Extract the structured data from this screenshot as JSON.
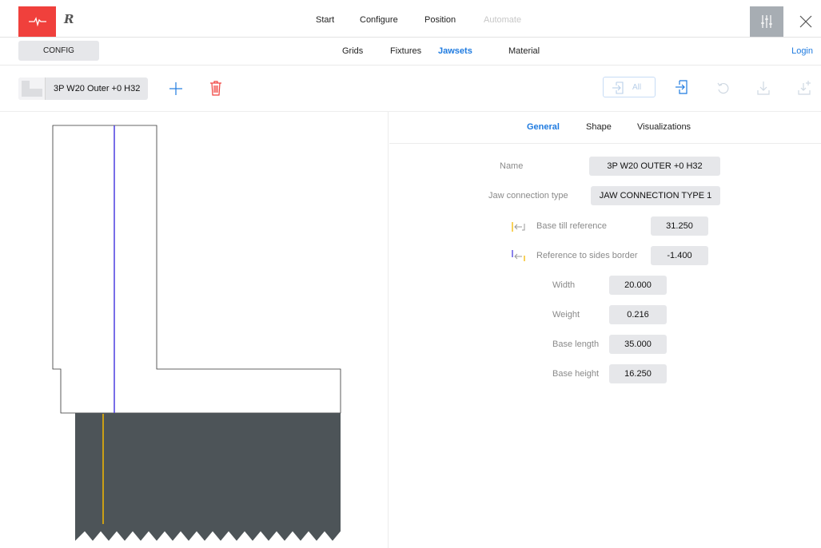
{
  "topbar": {
    "brand": "R",
    "nav": [
      {
        "label": "Start",
        "enabled": true
      },
      {
        "label": "Configure",
        "enabled": true
      },
      {
        "label": "Position",
        "enabled": true
      },
      {
        "label": "Automate",
        "enabled": false
      }
    ],
    "icons": {
      "logo": "heartbeat-icon",
      "settings": "sliders-icon",
      "close": "close-icon"
    }
  },
  "subnav": {
    "config_label": "CONFIG",
    "tabs": [
      {
        "label": "Grids",
        "active": false
      },
      {
        "label": "Fixtures",
        "active": false
      },
      {
        "label": "Jawsets",
        "active": true
      },
      {
        "label": "Material",
        "active": false
      }
    ],
    "login_label": "Login"
  },
  "toolbar": {
    "selected_jawset": "3P W20 Outer +0 H32",
    "all_label": "All",
    "icons": [
      "plus-icon",
      "trash-icon",
      "import-all-icon",
      "import-icon",
      "undo-icon",
      "download-icon",
      "download-add-icon"
    ]
  },
  "panel": {
    "tabs": [
      {
        "label": "General",
        "active": true
      },
      {
        "label": "Shape",
        "active": false
      },
      {
        "label": "Visualizations",
        "active": false
      }
    ],
    "fields": {
      "name": {
        "label": "Name",
        "value": "3P W20 OUTER +0 H32"
      },
      "connection": {
        "label": "Jaw connection type",
        "value": "JAW CONNECTION TYPE 1"
      },
      "base_till_reference": {
        "label": "Base till reference",
        "value": "31.250"
      },
      "reference_to_sides": {
        "label": "Reference to sides border",
        "value": "-1.400"
      },
      "width": {
        "label": "Width",
        "value": "20.000"
      },
      "weight": {
        "label": "Weight",
        "value": "0.216"
      },
      "base_length": {
        "label": "Base length",
        "value": "35.000"
      },
      "base_height": {
        "label": "Base height",
        "value": "16.250"
      }
    }
  },
  "colors": {
    "accent": "#1f7be0",
    "logo_bg": "#f0403c",
    "reference_yellow": "#f5b800",
    "reference_blue": "#4b3fe0",
    "material_dark": "#4d5458",
    "field_bg": "#e6e7ea"
  }
}
